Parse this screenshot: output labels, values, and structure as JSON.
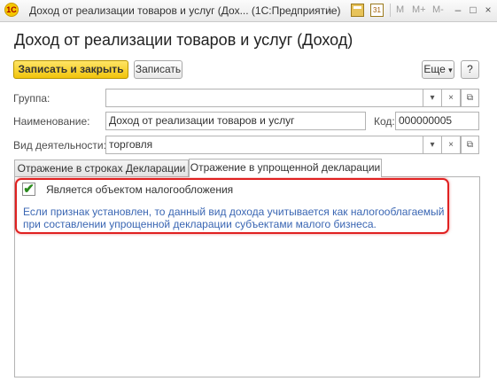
{
  "window": {
    "title": "Доход от реализации товаров и услуг (Дох...  (1С:Предприятие)",
    "app_icon_text": "1С",
    "mem_buttons": [
      "M",
      "M+",
      "M-"
    ],
    "controls": {
      "minimize": "–",
      "maximize": "□",
      "close": "×"
    }
  },
  "form": {
    "title": "Доход от реализации товаров и услуг (Доход)",
    "toolbar": {
      "save_close_label": "Записать и закрыть",
      "save_label": "Записать",
      "more_label": "Еще",
      "help_label": "?"
    },
    "fields": {
      "group": {
        "label": "Группа:",
        "value": ""
      },
      "name": {
        "label": "Наименование:",
        "value": "Доход от реализации товаров и услуг"
      },
      "code": {
        "label": "Код:",
        "value": "000000005"
      },
      "activity": {
        "label": "Вид деятельности:",
        "value": "торговля"
      }
    },
    "tabs": [
      {
        "label": "Отражение в строках Декларации",
        "active": false
      },
      {
        "label": "Отражение в упрощенной декларации",
        "active": true
      }
    ],
    "taxable_checkbox": {
      "label": "Является объектом налогообложения",
      "checked": true
    },
    "hint": "Если признак установлен, то данный вид дохода учитывается как налогооблагаемый при составлении упрощенной декларации субъектами малого бизнеса."
  },
  "colors": {
    "primary_button": "#f1c40c",
    "hint_text": "#3a66b3",
    "highlight": "#e02020"
  },
  "icons": {
    "dropdown": "▾",
    "clear": "×",
    "open": "⧉",
    "star": "☆",
    "check": "✔"
  }
}
